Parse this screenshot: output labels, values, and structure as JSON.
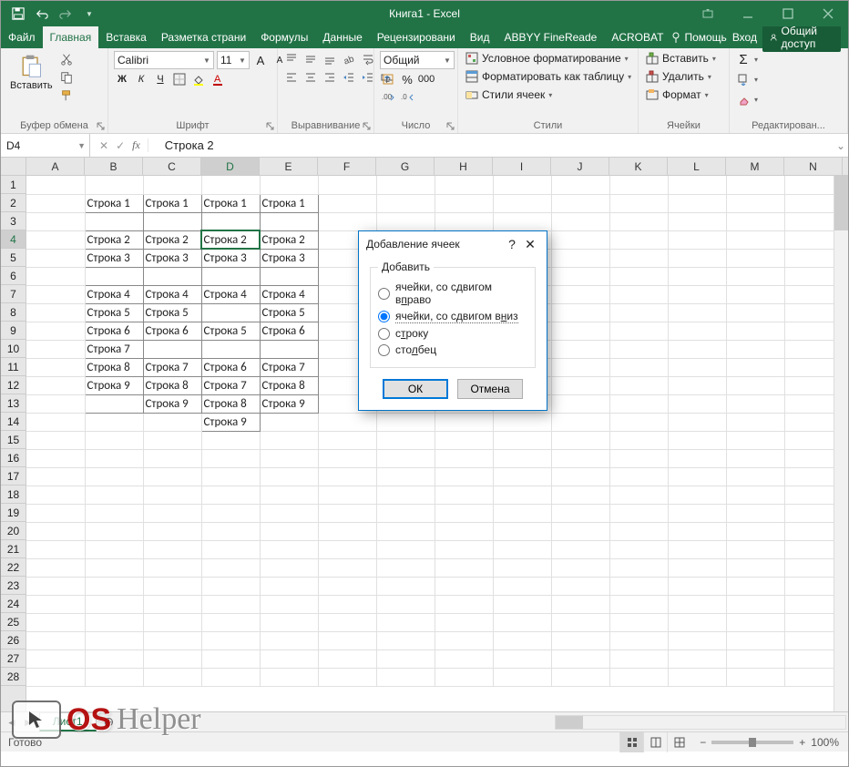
{
  "app_title": "Книга1 - Excel",
  "tabs": [
    "Файл",
    "Главная",
    "Вставка",
    "Разметка страни",
    "Формулы",
    "Данные",
    "Рецензировани",
    "Вид",
    "ABBYY FineReade",
    "ACROBAT"
  ],
  "active_tab_index": 1,
  "help_label": "Помощь",
  "signin_label": "Вход",
  "share_label": "Общий доступ",
  "ribbon_groups": {
    "clipboard": {
      "label": "Буфер обмена",
      "paste": "Вставить"
    },
    "font": {
      "label": "Шрифт",
      "name": "Calibri",
      "size": "11",
      "bold": "Ж",
      "italic": "К",
      "underline": "Ч"
    },
    "alignment": {
      "label": "Выравнивание"
    },
    "number": {
      "label": "Число",
      "format": "Общий"
    },
    "styles": {
      "label": "Стили",
      "cond": "Условное форматирование",
      "table": "Форматировать как таблицу",
      "cell": "Стили ячеек"
    },
    "cells": {
      "label": "Ячейки",
      "insert": "Вставить",
      "delete": "Удалить",
      "format": "Формат"
    },
    "editing": {
      "label": "Редактирован..."
    }
  },
  "name_box": "D4",
  "formula_value": "Строка 2",
  "columns": [
    "A",
    "B",
    "C",
    "D",
    "E",
    "F",
    "G",
    "H",
    "I",
    "J",
    "K",
    "L",
    "M",
    "N"
  ],
  "active_col_index": 3,
  "row_count": 28,
  "active_row": 4,
  "cells": {
    "B2": "Строка 1",
    "C2": "Строка 1",
    "D2": "Строка 1",
    "E2": "Строка 1",
    "B4": "Строка 2",
    "C4": "Строка 2",
    "D4": "Строка 2",
    "E4": "Строка 2",
    "B5": "Строка 3",
    "C5": "Строка 3",
    "D5": "Строка 3",
    "E5": "Строка 3",
    "B7": "Строка 4",
    "C7": "Строка 4",
    "D7": "Строка 4",
    "E7": "Строка 4",
    "B8": "Строка 5",
    "C8": "Строка 5",
    "E8": "Строка 5",
    "B9": "Строка 6",
    "C9": "Строка 6",
    "D9": "Строка 5",
    "E9": "Строка 6",
    "B10": "Строка 7",
    "B11": "Строка 8",
    "C11": "Строка 7",
    "D11": "Строка 6",
    "E11": "Строка 7",
    "B12": "Строка 9",
    "C12": "Строка 8",
    "D12": "Строка 7",
    "E12": "Строка 8",
    "C13": "Строка 9",
    "D13": "Строка 8",
    "E13": "Строка 9",
    "D14": "Строка 9"
  },
  "filled_range": {
    "col_start": 1,
    "col_end": 4,
    "row_start": 2,
    "row_end": 13
  },
  "extra_filled": [
    "D14"
  ],
  "sheet_tab": "Лист1",
  "status_text": "Готово",
  "zoom_label": "100%",
  "dialog": {
    "title": "Добавление ячеек",
    "legend": "Добавить",
    "options": [
      "ячейки, со сдвигом вправо",
      "ячейки, со сдвигом вниз",
      "строку",
      "столбец"
    ],
    "option_accel": [
      "п",
      "н",
      "т",
      "л"
    ],
    "selected_index": 1,
    "ok": "ОК",
    "cancel": "Отмена"
  },
  "watermark": {
    "os": "OS",
    "helper": "Helper"
  }
}
